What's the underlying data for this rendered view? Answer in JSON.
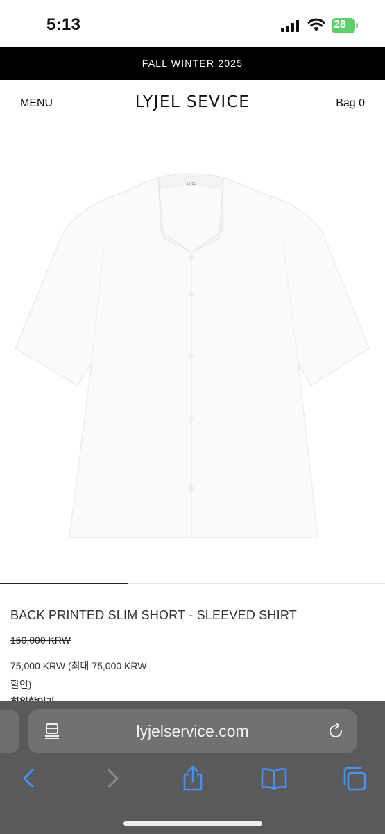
{
  "status_bar": {
    "time": "5:13",
    "battery": "28"
  },
  "banner": {
    "text": "FALL WINTER 2025"
  },
  "header": {
    "menu_label": "MENU",
    "logo": "LYJEL SEVICE",
    "bag_label": "Bag 0"
  },
  "gallery": {
    "progress": 0.333,
    "shirt_label": "LYJEL"
  },
  "product": {
    "title": "BACK PRINTED SLIM SHORT - SLEEVED SHIRT",
    "original_price": "150,000 KRW",
    "sale_price": "75,000 KRW (최대 75,000 KRW 할인)",
    "cut_off_text": "회원할인가"
  },
  "browser": {
    "url": "lyjelservice.com"
  },
  "colors": {
    "banner_bg": "#000000",
    "battery_green": "#5dd06b",
    "safari_bar": "#5a5a5c",
    "toolbar_icon_blue": "#3b82f6"
  }
}
